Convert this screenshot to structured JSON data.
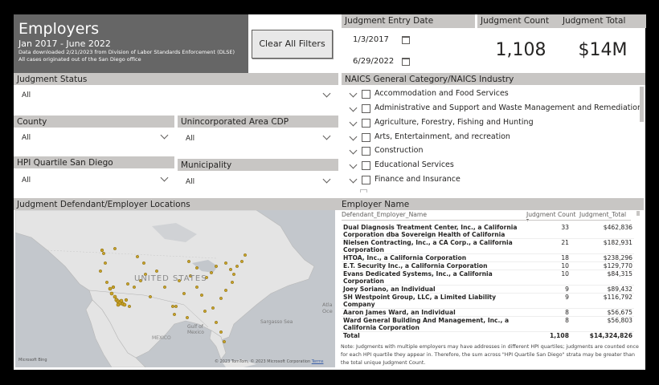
{
  "title_tile": {
    "title": "Employers",
    "period": "Jan 2017 - June 2022",
    "note1": "Data downloaded 2/21/2023 from Division of Labor Standards Enforcement (DLSE)",
    "note2": "All cases originated out of the San Diego office"
  },
  "clear_filters_label": "Clear All Filters",
  "judgment_entry_date": {
    "label": "Judgment Entry Date",
    "start": "1/3/2017",
    "end": "6/29/2022"
  },
  "cards": {
    "count_label": "Judgment Count",
    "count_value": "1,108",
    "total_label": "Judgment Total",
    "total_value": "$14M"
  },
  "slicers": {
    "judgment_status": {
      "label": "Judgment Status",
      "value": "All"
    },
    "county": {
      "label": "County",
      "value": "All"
    },
    "cdp": {
      "label": "Unincorporated Area CDP",
      "value": "All"
    },
    "hpi": {
      "label": "HPI Quartile San Diego",
      "value": "All"
    },
    "municipality": {
      "label": "Municipality",
      "value": "All"
    }
  },
  "naics": {
    "label": "NAICS General Category/NAICS Industry",
    "items": [
      "Accommodation and Food Services",
      "Administrative and Support and Waste Management and Remediation Servi...",
      "Agriculture, Forestry, Fishing and Hunting",
      "Arts, Entertainment, and recreation",
      "Construction",
      "Educational Services",
      "Finance and Insurance"
    ]
  },
  "map": {
    "label": "Judgment Defendant/Employer Locations",
    "country_label": "UNITED STATES",
    "mexico_label": "MEXICO",
    "gulf_label1": "Gulf of",
    "gulf_label2": "Mexico",
    "sargasso_label": "Sargasso Sea",
    "atlantic_label1": "Atla",
    "atlantic_label2": "Oce",
    "attribution": "© 2023 TomTom, © 2023 Microsoft Corporation",
    "terms": "Terms",
    "bing": "Microsoft Bing"
  },
  "employer_table": {
    "label": "Employer Name",
    "columns": [
      "Defendant_Employer_Name",
      "Judgment Count",
      "Judgment_Total"
    ],
    "rows": [
      {
        "name1": "Dual Diagnosis Treatment Center, Inc., a California",
        "name2": "Corporation dba Sovereign Health of California",
        "count": "33",
        "total": "$462,836"
      },
      {
        "name1": "Nielsen Contracting, Inc., a CA Corp., a California",
        "name2": "Corporation",
        "count": "21",
        "total": "$182,931"
      },
      {
        "name1": "HTOA, Inc., a California Corporation",
        "name2": "",
        "count": "18",
        "total": "$238,296"
      },
      {
        "name1": "E.T. Security Inc., a California Corporation",
        "name2": "",
        "count": "10",
        "total": "$129,770"
      },
      {
        "name1": "Evans Dedicated Systems, Inc., a California Corporation",
        "name2": "",
        "count": "10",
        "total": "$84,315"
      },
      {
        "name1": "Joey Soriano, an Individual",
        "name2": "",
        "count": "9",
        "total": "$89,432"
      },
      {
        "name1": "SH Westpoint Group, LLC, a Limited Liability Company",
        "name2": "",
        "count": "9",
        "total": "$116,792"
      },
      {
        "name1": "Aaron James Ward, an Individual",
        "name2": "",
        "count": "8",
        "total": "$56,675"
      },
      {
        "name1": "Ward General Building And Management, Inc., a",
        "name2": "California Corporation",
        "count": "8",
        "total": "$56,803"
      }
    ],
    "total_row": {
      "label": "Total",
      "count": "1,108",
      "total": "$14,324,826"
    }
  },
  "footnote": "Note: Judgments with multiple employers may have addresses in different HPI quartiles; judgments are counted once for each HPI quartile they appear in. Therefore, the sum across \"HPI Quartile San Diego\" strata may be greater than the total unique Judgment Count."
}
